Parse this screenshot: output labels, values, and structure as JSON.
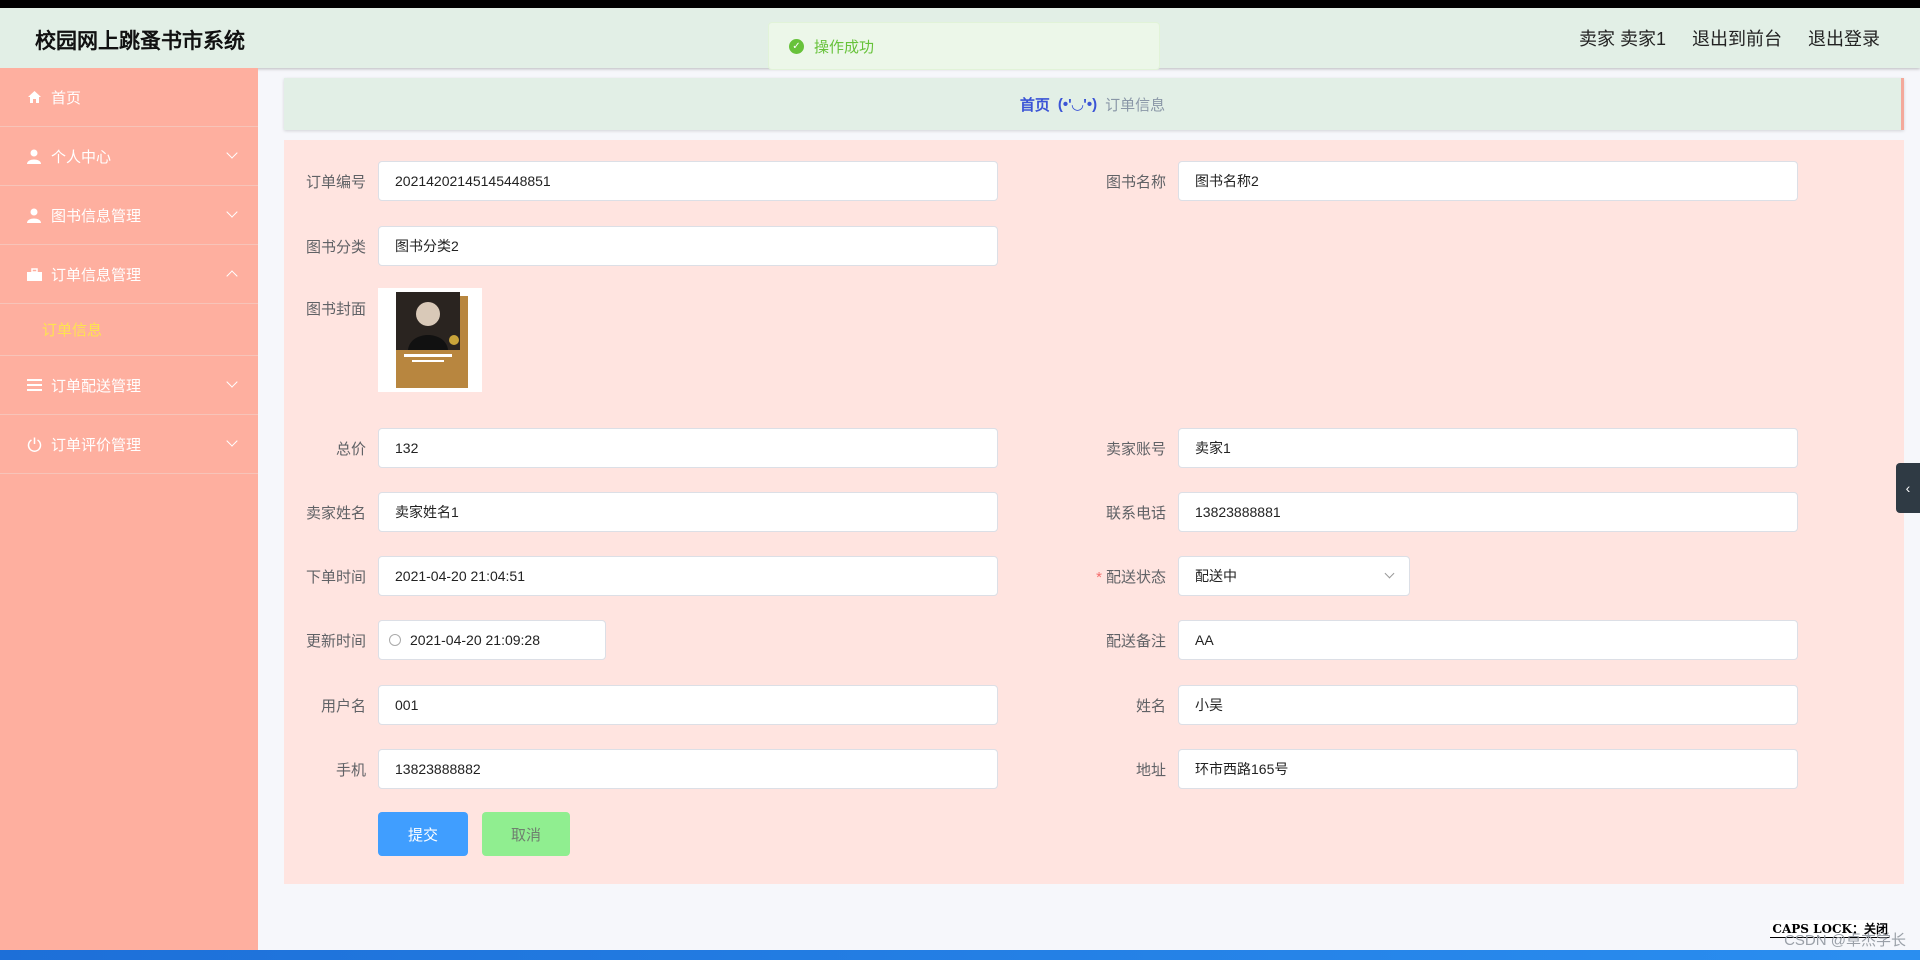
{
  "header": {
    "title": "校园网上跳蚤书市系统",
    "user": "卖家 卖家1",
    "to_front": "退出到前台",
    "logout": "退出登录"
  },
  "toast": {
    "message": "操作成功"
  },
  "sidebar": {
    "items": [
      {
        "label": "首页",
        "icon": "home-icon"
      },
      {
        "label": "个人中心",
        "icon": "user-icon"
      },
      {
        "label": "图书信息管理",
        "icon": "user-icon"
      },
      {
        "label": "订单信息管理",
        "icon": "briefcase-icon",
        "expanded": true
      },
      {
        "label": "订单配送管理",
        "icon": "list-icon"
      },
      {
        "label": "订单评价管理",
        "icon": "power-icon"
      }
    ],
    "sub_item": "订单信息"
  },
  "breadcrumb": {
    "home": "首页",
    "sep": "(•'◡'•)",
    "current": "订单信息"
  },
  "form": {
    "order_no": {
      "label": "订单编号",
      "value": "20214202145145448851"
    },
    "book_name": {
      "label": "图书名称",
      "value": "图书名称2"
    },
    "book_category": {
      "label": "图书分类",
      "value": "图书分类2"
    },
    "book_cover": {
      "label": "图书封面"
    },
    "total": {
      "label": "总价",
      "value": "132"
    },
    "seller_account": {
      "label": "卖家账号",
      "value": "卖家1"
    },
    "seller_name": {
      "label": "卖家姓名",
      "value": "卖家姓名1"
    },
    "phone": {
      "label": "联系电话",
      "value": "13823888881"
    },
    "order_time": {
      "label": "下单时间",
      "value": "2021-04-20 21:04:51"
    },
    "delivery_status": {
      "label": "配送状态",
      "value": "配送中"
    },
    "update_time": {
      "label": "更新时间",
      "value": "2021-04-20 21:09:28"
    },
    "delivery_note": {
      "label": "配送备注",
      "value": "AA"
    },
    "username": {
      "label": "用户名",
      "value": "001"
    },
    "name": {
      "label": "姓名",
      "value": "小吴"
    },
    "mobile": {
      "label": "手机",
      "value": "13823888882"
    },
    "address": {
      "label": "地址",
      "value": "环市西路165号"
    },
    "submit": "提交",
    "cancel": "取消"
  },
  "status_bar": {
    "caps": "CAPS LOCK：关闭",
    "watermark": "CSDN @卓杰学长"
  },
  "colors": {
    "submit": "#409eff",
    "cancel": "#90ee90",
    "sidebar": "#feaf9f",
    "header": "#e2efe6"
  }
}
